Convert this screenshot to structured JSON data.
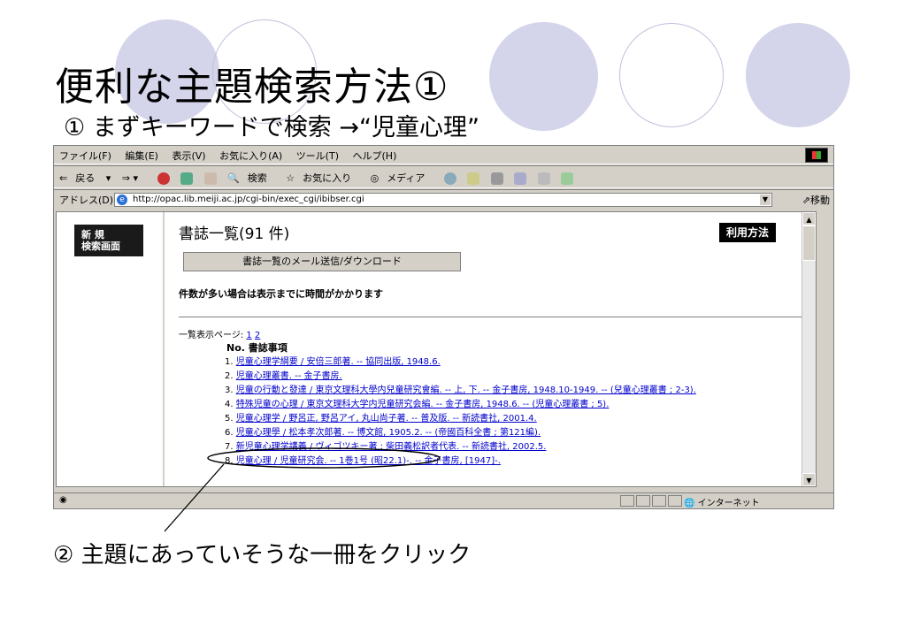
{
  "slide": {
    "title": "便利な主題検索方法①",
    "step1": "① まずキーワードで検索 →“児童心理”",
    "step2": "② 主題にあっていそうな一冊をクリック"
  },
  "browser": {
    "menu": [
      "ファイル(F)",
      "編集(E)",
      "表示(V)",
      "お気に入り(A)",
      "ツール(T)",
      "ヘルプ(H)"
    ],
    "toolbar": {
      "back": "戻る",
      "search": "検索",
      "favorites": "お気に入り",
      "media": "メディア"
    },
    "address_label": "アドレス(D)",
    "address_url": "http://opac.lib.meiji.ac.jp/cgi-bin/exec_cgi/ibibser.cgi",
    "go_label": "移動",
    "status_zone": "インターネット"
  },
  "page": {
    "new_search_button": "新 規\n検索画面",
    "results_title": "書誌一覧(91 件)",
    "usage_button": "利用方法",
    "mail_button": "書誌一覧のメール送信/ダウンロード",
    "notice": "件数が多い場合は表示までに時間がかかります",
    "pages_label": "一覧表示ページ:",
    "pages": [
      "1",
      "2"
    ],
    "list_header_no": "No.",
    "list_header_item": "書誌事項",
    "results": [
      {
        "no": "1.",
        "text": "児童心理学綱要 / 安倍三郎著. -- 協同出版, 1948.6."
      },
      {
        "no": "2.",
        "text": "児童心理叢書. -- 金子書房."
      },
      {
        "no": "3.",
        "text": "児童の行動と發達 / 東京文理科大學内兒童研究會編. -- 上, 下. -- 金子書房, 1948.10-1949. -- (兒童心理叢書 ; 2-3)."
      },
      {
        "no": "4.",
        "text": "特殊児童の心理 / 東京文理科大学内児童研究会編. -- 金子書房, 1948.6. -- (児童心理叢書 ; 5)."
      },
      {
        "no": "5.",
        "text": "児童心理学 / 野呂正, 野呂アイ, 丸山尚子著. -- 普及版. -- 新読書社, 2001.4."
      },
      {
        "no": "6.",
        "text": "児童心理學 / 松本孝次郎著. -- 博文館, 1905.2. -- (帝國百科全書 ; 第121編)."
      },
      {
        "no": "7.",
        "text": "新児童心理学講義 / ヴィゴツキー著 ; 柴田義松訳者代表. -- 新読書社, 2002.5."
      },
      {
        "no": "8.",
        "text": "児童心理 / 児童研究会. -- 1巻1号 (昭22.1)-. -- 金子書房, [1947]-."
      }
    ]
  },
  "colors": {
    "deco_fill": "#d4d4ea",
    "link": "#0000cc",
    "chrome": "#d4d0c8"
  }
}
